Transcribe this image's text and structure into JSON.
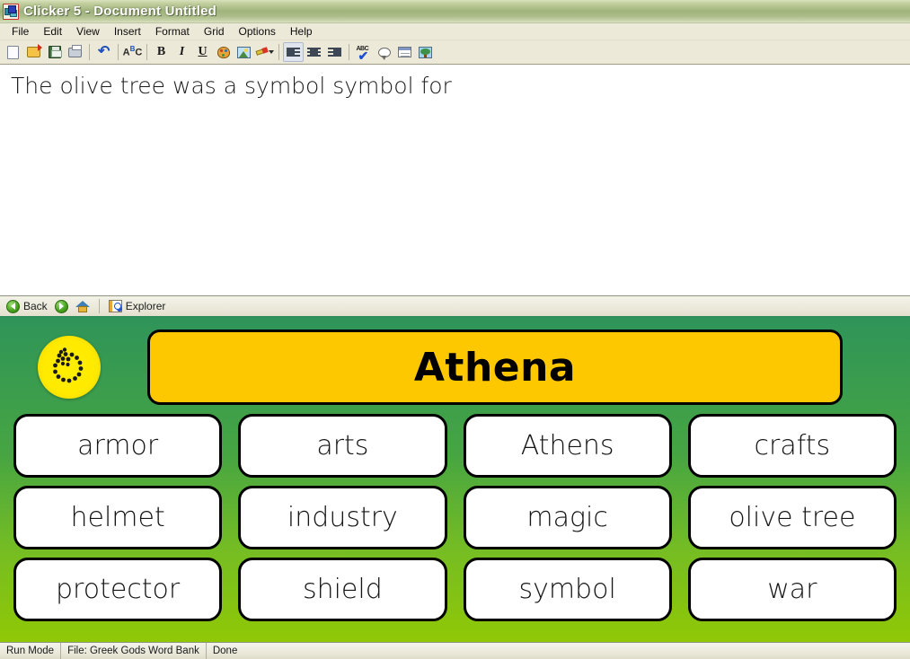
{
  "window": {
    "title": "Clicker 5 - Document Untitled",
    "app_icon": "clicker-app-icon"
  },
  "menubar": {
    "items": [
      {
        "label": "File"
      },
      {
        "label": "Edit"
      },
      {
        "label": "View"
      },
      {
        "label": "Insert"
      },
      {
        "label": "Format"
      },
      {
        "label": "Grid"
      },
      {
        "label": "Options"
      },
      {
        "label": "Help"
      }
    ]
  },
  "toolbar": {
    "buttons": [
      {
        "name": "new-document-icon",
        "type": "icon"
      },
      {
        "name": "open-document-icon",
        "type": "icon"
      },
      {
        "name": "save-document-icon",
        "type": "icon"
      },
      {
        "name": "print-icon",
        "type": "icon"
      },
      {
        "name": "undo-icon",
        "type": "icon"
      },
      {
        "name": "spelling-abc-icon",
        "type": "icon"
      },
      {
        "name": "bold-button",
        "type": "text",
        "label": "B"
      },
      {
        "name": "italic-button",
        "type": "text",
        "label": "I"
      },
      {
        "name": "underline-button",
        "type": "text",
        "label": "U"
      },
      {
        "name": "text-color-icon",
        "type": "icon"
      },
      {
        "name": "highlight-color-icon",
        "type": "icon"
      },
      {
        "name": "highlighter-pen-icon",
        "type": "icon"
      },
      {
        "name": "align-left-icon",
        "type": "icon"
      },
      {
        "name": "align-center-icon",
        "type": "icon"
      },
      {
        "name": "align-right-icon",
        "type": "icon"
      },
      {
        "name": "spell-check-icon",
        "type": "icon"
      },
      {
        "name": "speech-bubble-icon",
        "type": "icon"
      },
      {
        "name": "show-grid-icon",
        "type": "icon"
      },
      {
        "name": "insert-picture-icon",
        "type": "icon"
      }
    ]
  },
  "document": {
    "text": "The olive tree was a symbol symbol for"
  },
  "gridnav": {
    "back_label": "Back",
    "explorer_label": "Explorer"
  },
  "grid": {
    "spin_button_name": "replay-speech-button",
    "title_cell": {
      "label": "Athena",
      "bg_color": "#fec800"
    },
    "background_top_color": "#2f9459",
    "background_bottom_color": "#90c805",
    "rows": [
      [
        {
          "label": "armor"
        },
        {
          "label": "arts"
        },
        {
          "label": "Athens"
        },
        {
          "label": "crafts"
        }
      ],
      [
        {
          "label": "helmet"
        },
        {
          "label": "industry"
        },
        {
          "label": "magic"
        },
        {
          "label": "olive tree"
        }
      ],
      [
        {
          "label": "protector"
        },
        {
          "label": "shield"
        },
        {
          "label": "symbol"
        },
        {
          "label": "war"
        }
      ]
    ]
  },
  "statusbar": {
    "mode": "Run Mode",
    "file": "File: Greek Gods Word Bank",
    "status": "Done"
  }
}
